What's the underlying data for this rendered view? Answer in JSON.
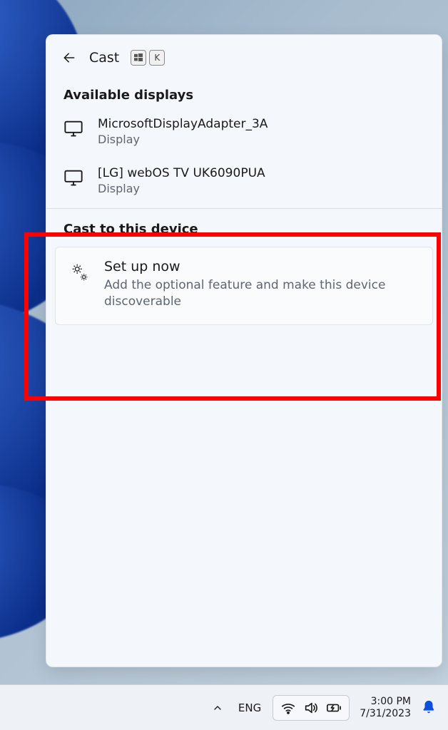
{
  "panel": {
    "title": "Cast",
    "shortcut_key": "K",
    "available_label": "Available displays",
    "devices": [
      {
        "name": "MicrosoftDisplayAdapter_3A",
        "subtitle": "Display"
      },
      {
        "name": "[LG] webOS TV UK6090PUA",
        "subtitle": "Display"
      }
    ],
    "cast_to_label": "Cast to this device",
    "setup": {
      "title": "Set up now",
      "description": "Add the optional feature and make this device discoverable"
    }
  },
  "taskbar": {
    "language": "ENG",
    "time": "3:00 PM",
    "date": "7/31/2023"
  }
}
